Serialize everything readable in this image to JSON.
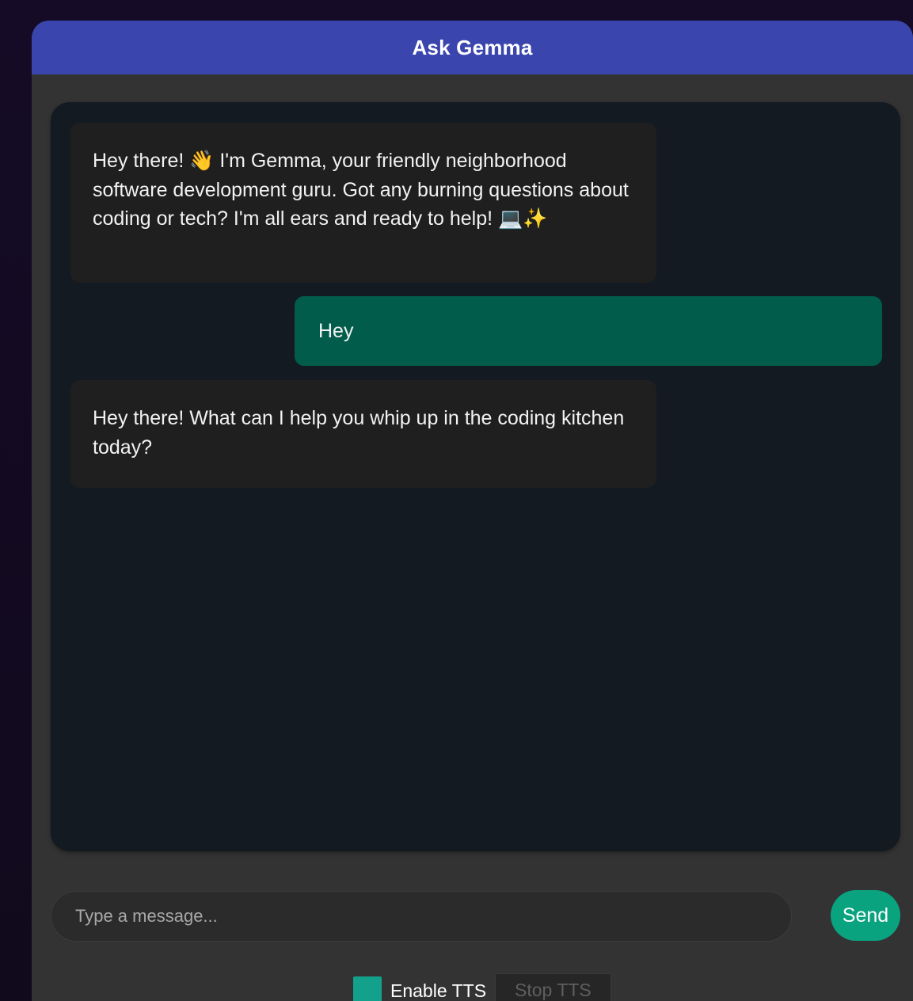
{
  "header": {
    "title": "Ask Gemma"
  },
  "messages": [
    {
      "role": "bot",
      "text": "Hey there! 👋 I'm Gemma, your friendly neighborhood software development guru. Got any burning questions about coding or tech? I'm all ears and ready to help! 💻✨"
    },
    {
      "role": "user",
      "text": "Hey"
    },
    {
      "role": "bot",
      "text": "Hey there! What can I help you whip up in the coding kitchen today?"
    }
  ],
  "input": {
    "placeholder": "Type a message...",
    "value": ""
  },
  "send": {
    "label": "Send"
  },
  "tts": {
    "enable_label": "Enable TTS",
    "enabled": true,
    "stop_label": "Stop TTS"
  },
  "colors": {
    "header_bg": "#3a45ad",
    "chat_bg": "#131a22",
    "bot_bubble": "#1f1f1f",
    "user_bubble": "#015c4b",
    "send_button": "#0aa380",
    "checkbox": "#13a18b"
  }
}
